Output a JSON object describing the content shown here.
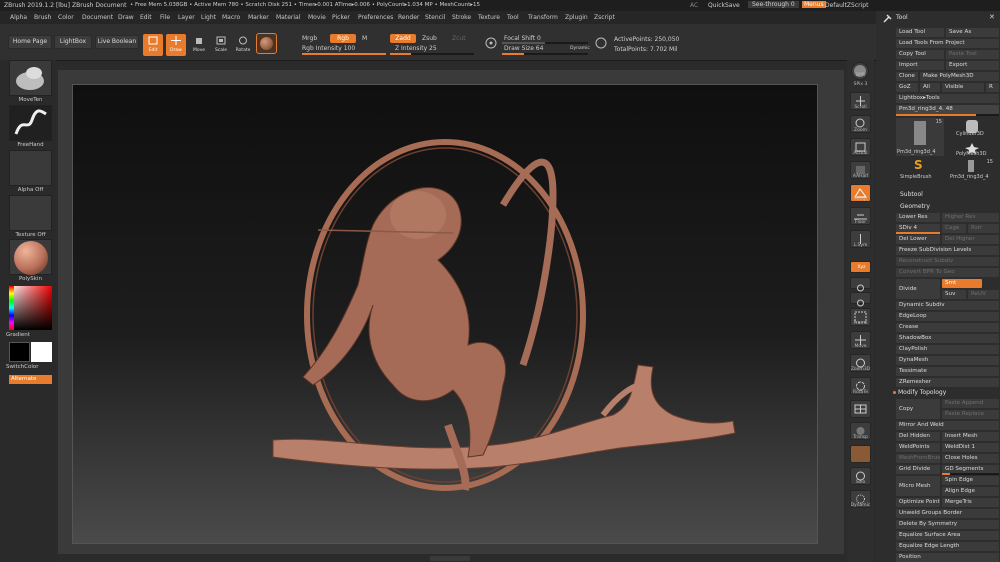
{
  "titlebar": {
    "app": "ZBrush 2019.1.2 [lbu]",
    "document": "ZBrush Document",
    "stats": "• Free Mem 5.038GB • Active Mem 780 • Scratch Disk 251 • Timer▸0.001 ATime▸0.006 • PolyCount▸1.034 MP • MeshCount▸15",
    "ac": "AC",
    "quicksave": "QuickSave",
    "seethrough": "See-through 0",
    "menus_btn": "Menus",
    "script": "DefaultZScript"
  },
  "menus": [
    "Alpha",
    "Brush",
    "Color",
    "Document",
    "Draw",
    "Edit",
    "File",
    "Layer",
    "Light",
    "Macro",
    "Marker",
    "Material",
    "Movie",
    "Picker",
    "Preferences",
    "Render",
    "Stencil",
    "Stroke",
    "Texture",
    "Tool",
    "Transform",
    "Zplugin",
    "Zscript"
  ],
  "shelf": {
    "home": "Home Page",
    "lightbox": "LightBox",
    "live_boolean": "Live Boolean",
    "edit": "Edit",
    "draw": "Draw",
    "move": "Move",
    "scale": "Scale",
    "rotate": "Rotate",
    "mrgb": "Mrgb",
    "rgb": "Rgb",
    "m": "M",
    "rgb_intensity": "Rgb Intensity 100",
    "rgb_intensity_value": 100,
    "zadd": "Zadd",
    "zsub": "Zsub",
    "zcut": "Zcut",
    "z_intensity": "Z Intensity 25",
    "z_intensity_value": 25,
    "focal_shift": "Focal Shift 0",
    "draw_size": "Draw Size 64",
    "dynamic": "Dynamic",
    "active_points": "ActivePoints: 250,050",
    "total_points": "TotalPoints: 7.702 Mil"
  },
  "left_shelf": {
    "brush": "MoveTen",
    "stroke": "FreeHand",
    "alpha": "Alpha Off",
    "texture": "Texture Off",
    "material": "PolySkin",
    "gradient": "Gradient",
    "switch_color": "SwitchColor",
    "alternate": "Alternate",
    "accent": "#e87c2c"
  },
  "right_toolbar": [
    "BPR",
    "SPix 3",
    "Scroll",
    "Zoom",
    "Actual",
    "AAHalf",
    "Persp",
    "Floor",
    "L.Sym",
    "Xyz",
    "",
    "",
    "Frame",
    "Move",
    "Zoom3D",
    "RotaTe",
    "",
    "Transp",
    "",
    "Solo",
    "Dynamic"
  ],
  "palette": {
    "title": "Tool",
    "load_tool": "Load Tool",
    "save_as": "Save As",
    "load_from_project": "Load Tools From Project",
    "copy_tool": "Copy Tool",
    "paste_tool": "Paste Tool",
    "import": "Import",
    "export": "Export",
    "clone": "Clone",
    "make_polymesh": "Make PolyMesh3D",
    "goz": "GoZ",
    "all": "All",
    "visible": "Visible",
    "r": "R",
    "lightbox_tools": "Lightbox▸Tools",
    "current_tool": "Pm3d_ring3d_4. 48",
    "thumbs": [
      {
        "name": "Pm3d_ring3d_4",
        "count": "15"
      },
      {
        "name": "Cylinder3D",
        "count": ""
      },
      {
        "name": "PolyMesh3D",
        "count": ""
      },
      {
        "name": "SimpleBrush",
        "count": ""
      },
      {
        "name": "Pm3d_ring3d_4",
        "count": "15"
      }
    ],
    "subtool": "Subtool",
    "geometry": "Geometry",
    "lower_res": "Lower Res",
    "higher_res": "Higher Res",
    "sdiv": "SDiv 4",
    "cage": "Cage",
    "rstr": "Rstr",
    "del_lower": "Del Lower",
    "del_higher": "Del Higher",
    "freeze_subdiv": "Freeze SubDivision Levels",
    "reconstruct_subdiv": "Reconstruct Subdiv",
    "convert_bpr": "Convert BPR To Geo",
    "divide": "Divide",
    "smt": "Smt",
    "suv": "Suv",
    "reuv": "ReUV",
    "items": [
      "Dynamic Subdiv",
      "EdgeLoop",
      "Crease",
      "ShadowBox",
      "ClayPolish",
      "DynaMesh",
      "Tessimate",
      "ZRemesher"
    ],
    "modify_topology": "Modify Topology",
    "copy": "Copy",
    "paste_append": "Paste Append",
    "paste_replace": "Paste Replace",
    "mirror_weld": "Mirror And Weld",
    "del_hidden": "Del Hidden",
    "insert_mesh": "Insert Mesh",
    "weldpoints": "WeldPoints",
    "welddist": "WeldDist 1",
    "meshfrombrush": "MeshFromBrush",
    "close_holes": "Close Holes",
    "grid_divide": "Grid Divide",
    "gd_segments": "GD Segments",
    "micro_mesh": "Micro Mesh",
    "spin_edge": "Spin Edge",
    "align_edge": "Align Edge",
    "optimize_point": "Optimize Point",
    "mergetris": "MergeTris",
    "unweld_groups": "Unweld Groups Border",
    "delete_symmetry": "Delete By Symmetry",
    "equalize_area": "Equalize Surface Area",
    "equalize_edge": "Equalize Edge Length",
    "position": "Position"
  }
}
